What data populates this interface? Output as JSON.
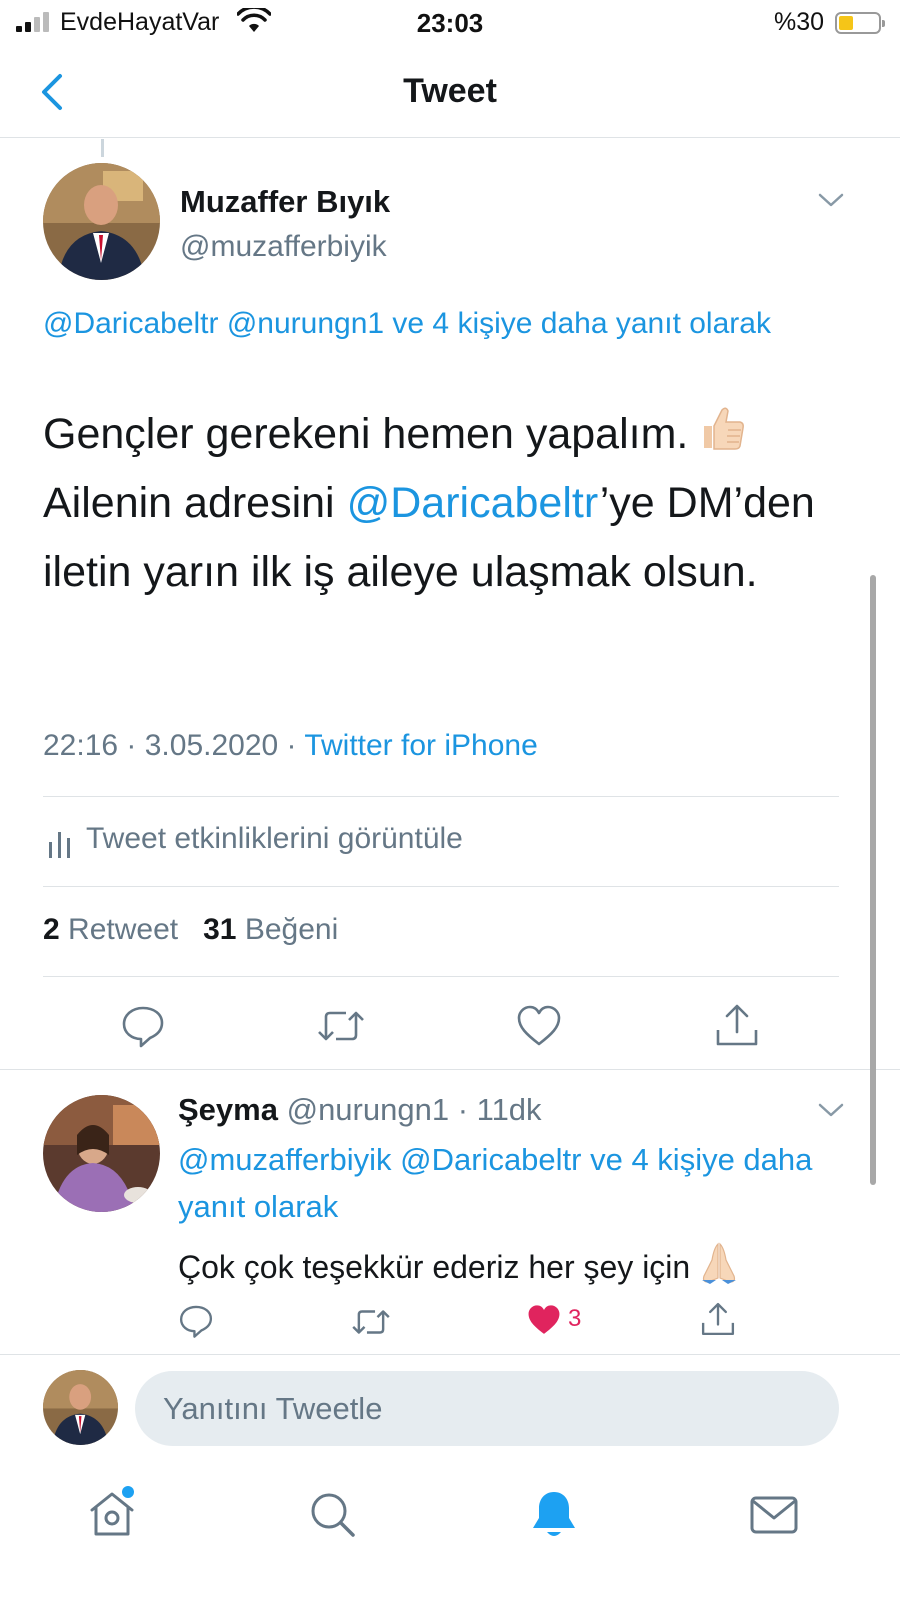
{
  "status_bar": {
    "carrier": "EvdeHayatVar",
    "time": "23:03",
    "battery_percent_text": "%30",
    "battery_level": 0.3,
    "battery_color": "#f5c518"
  },
  "nav": {
    "title": "Tweet",
    "back_icon": "chevron-left-icon",
    "accent_color": "#1b95e0"
  },
  "main_tweet": {
    "author_name": "Muzaffer Bıyık",
    "author_handle": "@muzafferbiyik",
    "reply_context": "@Daricabeltr @nurungn1 ve 4 kişiye daha yanıt olarak",
    "text_part1": "Gençler gerekeni hemen yapalım.",
    "text_emoji": "thumbs-up-emoji",
    "text_part2": "Ailenin adresini",
    "text_mention": "@Daricabeltr",
    "text_part3": "’ye DM’den iletin yarın ilk iş aileye ulaşmak olsun.",
    "timestamp": "22:16 · 3.05.2020 · ",
    "source": "Twitter for iPhone",
    "activity_label": "Tweet etkinliklerini görüntüle",
    "retweet_count": "2",
    "retweet_label": "Retweet",
    "like_count": "31",
    "like_label": "Beğeni",
    "actions": [
      "reply-icon",
      "retweet-icon",
      "like-icon",
      "share-icon"
    ]
  },
  "reply_tweet": {
    "author_name": "Şeyma",
    "author_handle": "@nurungn1",
    "time_ago": " · 11dk",
    "reply_context": "@muzafferbiyik @Daricabeltr ve 4 kişiye daha yanıt olarak",
    "text": "Çok çok teşekkür ederiz her şey için",
    "text_emoji": "folded-hands-emoji",
    "like_count": "3",
    "liked": true,
    "like_color": "#e0245e"
  },
  "compose": {
    "placeholder": "Yanıtını Tweetle"
  },
  "tab_bar": {
    "tabs": [
      "home-icon",
      "search-icon",
      "notifications-icon",
      "messages-icon"
    ],
    "active_tab": "notifications-icon",
    "home_has_badge": true
  }
}
